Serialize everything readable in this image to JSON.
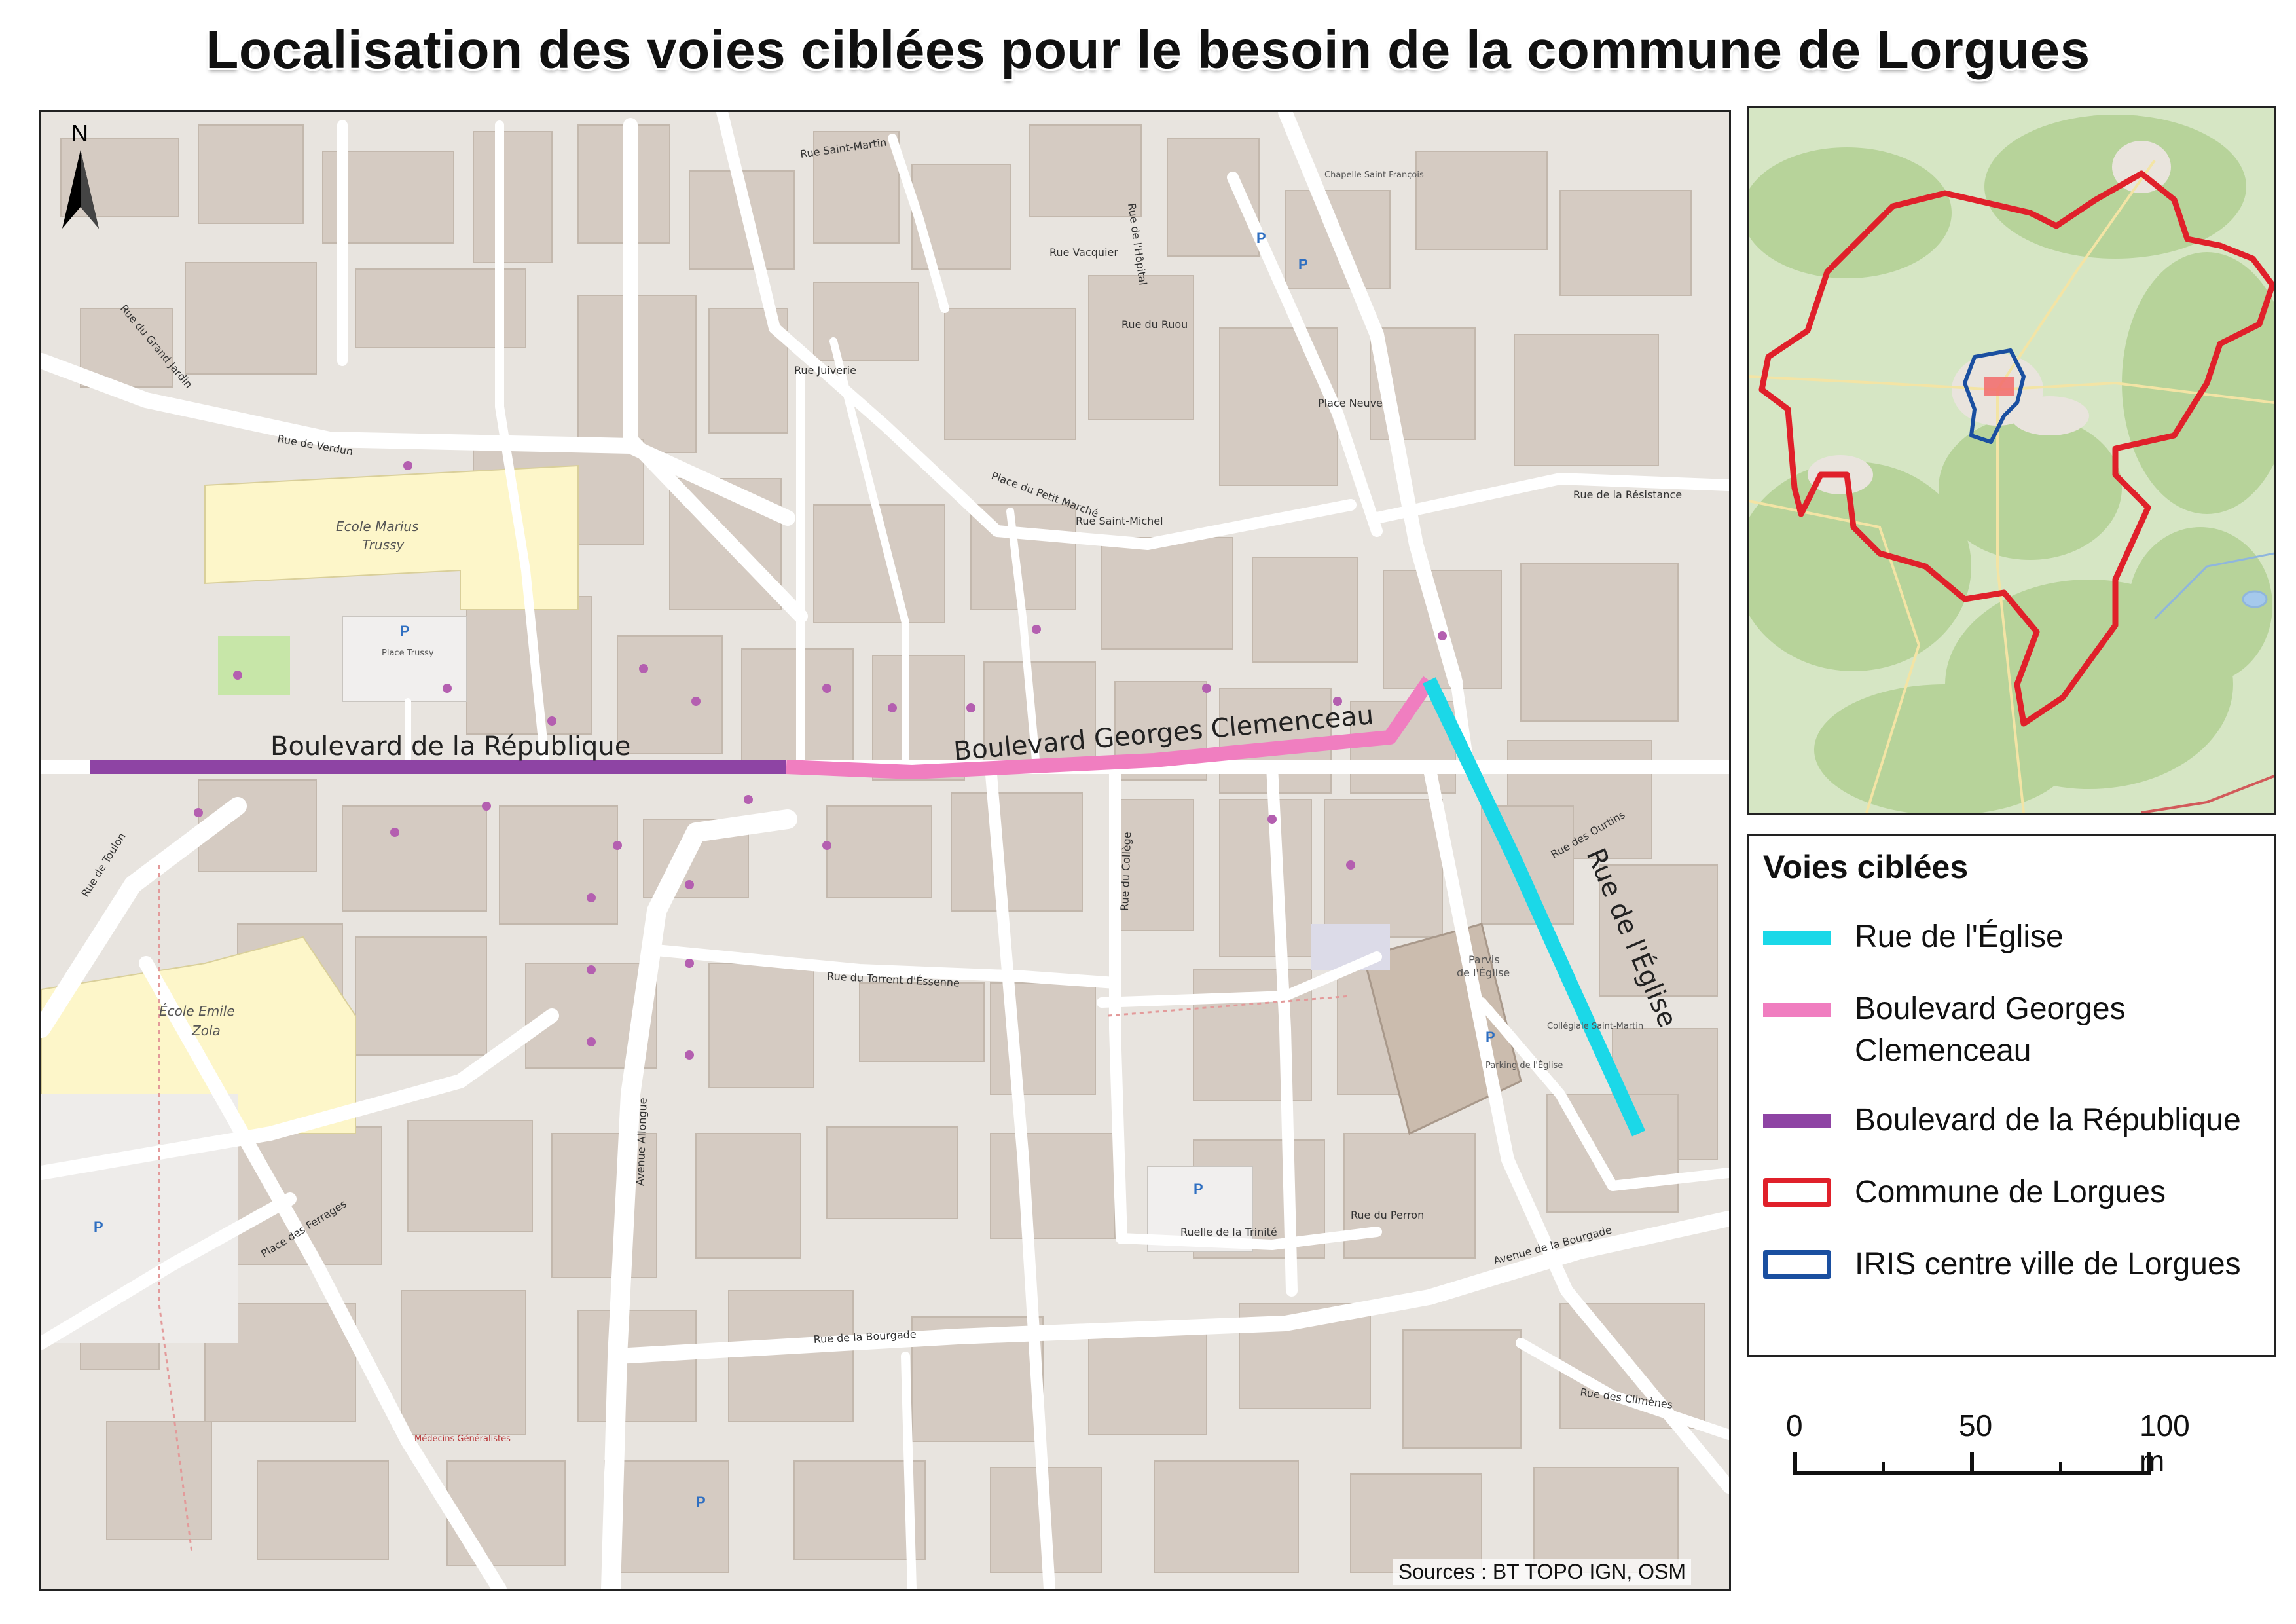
{
  "title": "Localisation des voies ciblées pour le besoin de la commune de Lorgues",
  "map": {
    "north_arrow_label": "N",
    "sources": "Sources : BT TOPO IGN, OSM",
    "target_roads": [
      {
        "label": "Boulevard de la République",
        "color": "#8e44a4"
      },
      {
        "label": "Boulevard Georges Clemenceau",
        "color": "#f07ec0"
      },
      {
        "label": "Rue de l'Église",
        "color": "#1bd8e8"
      }
    ],
    "street_labels": [
      "Rue de Verdun",
      "Rue Saint-Michel",
      "Place Neuve",
      "Rue de la Résistance",
      "Rue du Torrent d'Éssenne",
      "Rue de la Bourgade",
      "Avenue de la Bourgade",
      "Rue des Ourtins",
      "Place des Ferrages",
      "Avenue Allongue",
      "Rue du Collège",
      "Rue du Perron",
      "Ruelle de la Trinité",
      "Rue de Toulon",
      "Rue des Climènes",
      "Rue Juiverie",
      "Rue Vacquier",
      "Rue du Ruou",
      "Place du Petit Marché",
      "Rue de l'Hôpital",
      "Rue Saint-Martin",
      "Rue du Grand Jardin"
    ],
    "place_labels": [
      "Ecole Marius Trussy",
      "Ecole Emile Zola",
      "Parvis de l'Église",
      "Collégiale Saint-Martin",
      "Parking de l'Église",
      "Place Trussy",
      "Chapelle Saint François",
      "Médecins Généralistes"
    ]
  },
  "inset": {
    "commune_outline_color": "#e0202a",
    "iris_outline_color": "#1a4fa0"
  },
  "legend": {
    "title": "Voies ciblées",
    "items": [
      {
        "label": "Rue de l'Église",
        "type": "line",
        "color": "#1bd8e8"
      },
      {
        "label": "Boulevard Georges Clemenceau",
        "type": "line",
        "color": "#f07ec0"
      },
      {
        "label": "Boulevard de la République",
        "type": "line",
        "color": "#8e44a4"
      },
      {
        "label": "Commune de Lorgues",
        "type": "outline",
        "color": "#e0202a"
      },
      {
        "label": "IRIS centre ville de Lorgues",
        "type": "outline",
        "color": "#1a4fa0"
      }
    ]
  },
  "scalebar": {
    "labels": [
      "0",
      "50",
      "100 m"
    ]
  }
}
